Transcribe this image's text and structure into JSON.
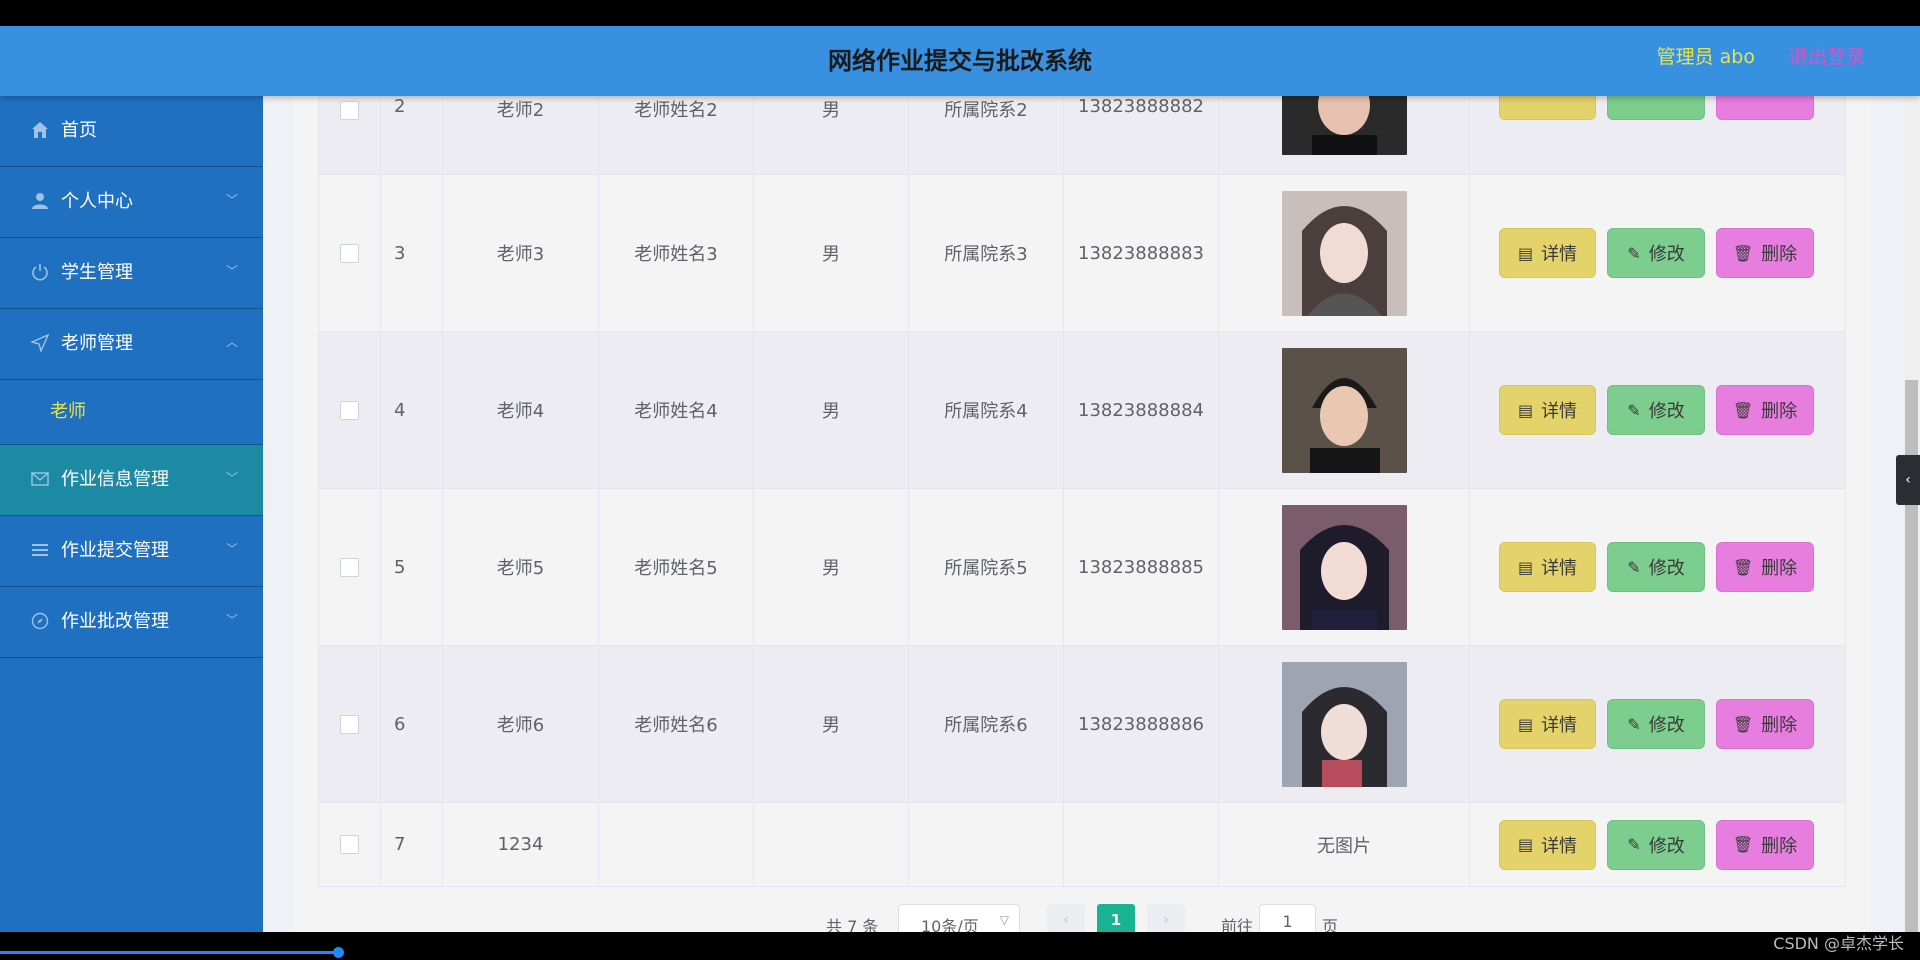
{
  "header": {
    "title": "网络作业提交与批改系统",
    "admin": "管理员 abo",
    "logout": "退出登录"
  },
  "sidebar": {
    "items": [
      {
        "label": "首页",
        "icon": "home-icon"
      },
      {
        "label": "个人中心",
        "icon": "user-icon"
      },
      {
        "label": "学生管理",
        "icon": "power-icon"
      },
      {
        "label": "老师管理",
        "icon": "send-icon"
      },
      {
        "label": "作业信息管理",
        "icon": "mail-icon"
      },
      {
        "label": "作业提交管理",
        "icon": "list-icon"
      },
      {
        "label": "作业批改管理",
        "icon": "compass-icon"
      }
    ],
    "submenu": {
      "label": "老师"
    }
  },
  "table": {
    "rows": [
      {
        "idx": "2",
        "acct": "老师2",
        "name": "老师姓名2",
        "sex": "男",
        "dept": "所属院系2",
        "phone": "13823888882",
        "photo": "photo"
      },
      {
        "idx": "3",
        "acct": "老师3",
        "name": "老师姓名3",
        "sex": "男",
        "dept": "所属院系3",
        "phone": "13823888883",
        "photo": "photo"
      },
      {
        "idx": "4",
        "acct": "老师4",
        "name": "老师姓名4",
        "sex": "男",
        "dept": "所属院系4",
        "phone": "13823888884",
        "photo": "photo"
      },
      {
        "idx": "5",
        "acct": "老师5",
        "name": "老师姓名5",
        "sex": "男",
        "dept": "所属院系5",
        "phone": "13823888885",
        "photo": "photo"
      },
      {
        "idx": "6",
        "acct": "老师6",
        "name": "老师姓名6",
        "sex": "男",
        "dept": "所属院系6",
        "phone": "13823888886",
        "photo": "photo"
      },
      {
        "idx": "7",
        "acct": "1234",
        "name": "",
        "sex": "",
        "dept": "",
        "phone": "",
        "photo": "无图片"
      }
    ],
    "buttons": {
      "detail": "详情",
      "edit": "修改",
      "delete": "删除"
    }
  },
  "pager": {
    "total": "共 7 条",
    "page_size": "10条/页",
    "current": "1",
    "goto": "前往",
    "goto_value": "1",
    "page_unit": "页"
  },
  "watermark": "CSDN @卓杰学长",
  "colors": {
    "header": "#3790e0",
    "sidebar": "#1f70c0",
    "accent_yellow": "#e7e44c",
    "logout": "#e04fc8",
    "btn_detail": "#e3d36a",
    "btn_edit": "#7ccd8e",
    "btn_delete": "#e87de0",
    "pager_active": "#19b394"
  }
}
